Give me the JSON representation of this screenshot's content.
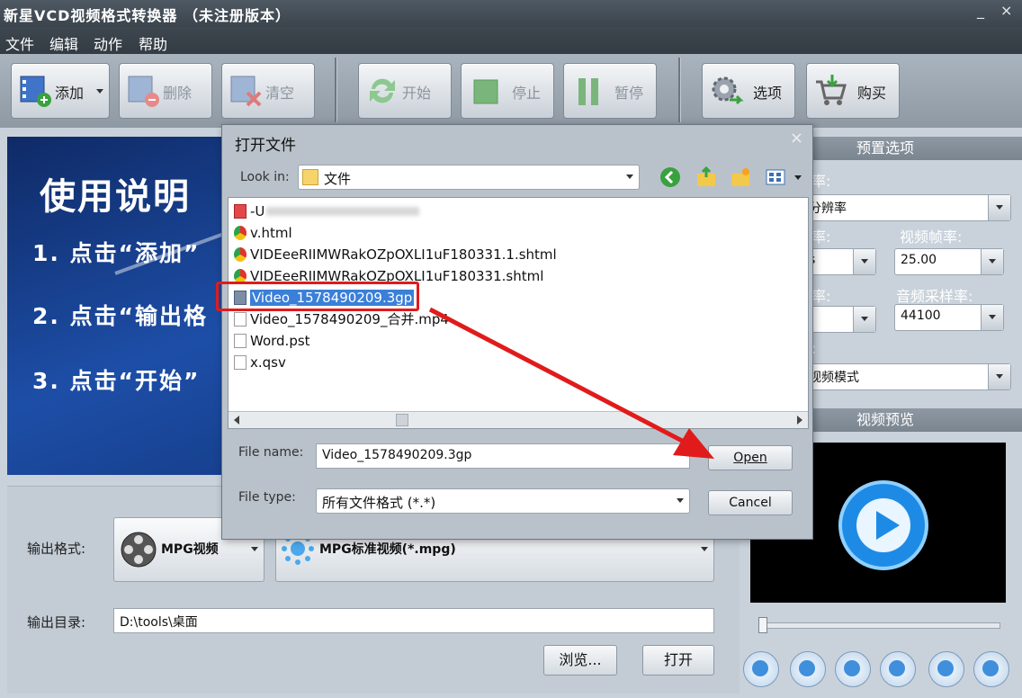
{
  "app": {
    "title": "新星VCD视频格式转换器 （未注册版本）",
    "min_symbol": "_",
    "close_symbol": "×"
  },
  "menu": [
    "文件",
    "编辑",
    "动作",
    "帮助"
  ],
  "toolbar": {
    "add": "添加",
    "delete": "删除",
    "clear": "清空",
    "start": "开始",
    "stop": "停止",
    "pause": "暂停",
    "options": "选项",
    "buy": "购买"
  },
  "instructions": {
    "title": "使用说明",
    "step1": "1. 点击“添加”",
    "step2": "2. 点击“输出格",
    "step3": "3. 点击“开始”"
  },
  "output": {
    "format_label": "输出格式:",
    "format_value": "MPG视频",
    "profile_value": "MPG标准视频(*.mpg)",
    "dir_label": "输出目录:",
    "dir_value": "D:\\tools\\桌面",
    "browse": "浏览...",
    "open": "打开"
  },
  "settings": {
    "header": "预置选项",
    "res_label": "率:",
    "res_value": "分辨率",
    "vrate_label": "率:",
    "vrate_value": "s",
    "fps_label": "视频帧率:",
    "fps_value": "25.00",
    "arate_label": "率:",
    "asample_label": "音频采样率:",
    "asample_value": "44100",
    "mode_label": ":",
    "mode_value": "视频模式"
  },
  "preview": {
    "header": "视频预览"
  },
  "dialog": {
    "title": "打开文件",
    "look_in_label": "Look in:",
    "look_in_value": "文件",
    "files": [
      "-U",
      "v.html",
      "VIDEeeRIIMWRakOZpOXLI1uF180331.1.shtml",
      "VIDEeeRIIMWRakOZpOXLI1uF180331.shtml",
      "Video_1578490209.3gp",
      "Video_1578490209_合并.mp4",
      "Word.pst",
      "x.qsv"
    ],
    "file_name_label": "File name:",
    "file_name_value": "Video_1578490209.3gp",
    "file_type_label": "File type:",
    "file_type_value": "所有文件格式 (*.*)",
    "open_button": "Open",
    "cancel_button": "Cancel",
    "close_symbol": "×"
  },
  "colors": {
    "annotation": "#e11b1b",
    "selection": "#3a7fd8"
  }
}
